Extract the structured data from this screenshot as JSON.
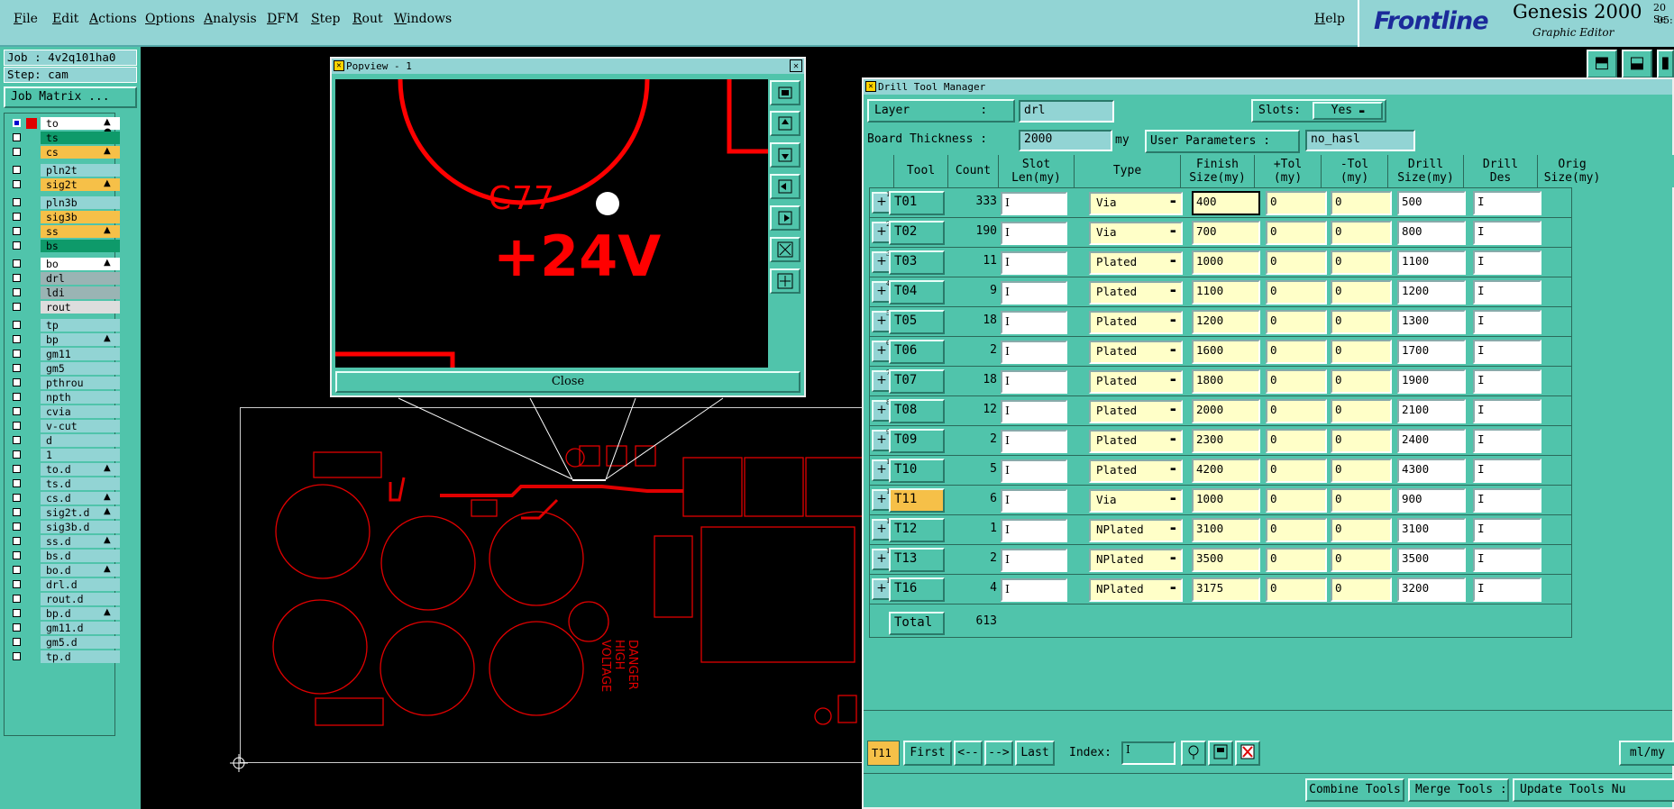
{
  "menu": [
    "File",
    "Edit",
    "Actions",
    "Options",
    "Analysis",
    "DFM",
    "Step",
    "Rout",
    "Windows"
  ],
  "help": "Help",
  "logo": {
    "brand": "Frontline",
    "product": "Genesis 2000",
    "sub": "Graphic Editor",
    "date1": "20 Se",
    "date2": "05:"
  },
  "left": {
    "job": "Job : 4v2q101ha0",
    "step": "Step: cam",
    "matrix_btn": "Job Matrix ...",
    "layers": [
      {
        "name": "to",
        "color": "#ffffff",
        "flag": "▲ ●",
        "sel": true
      },
      {
        "name": "ts",
        "color": "#0e9a6a",
        "flag": ""
      },
      {
        "name": "cs",
        "color": "#f6c048",
        "flag": "▲"
      },
      {
        "name": "pln2t",
        "color": "#92d4d4",
        "flag": ""
      },
      {
        "name": "sig2t",
        "color": "#f6c048",
        "flag": "▲"
      },
      {
        "name": "pln3b",
        "color": "#92d4d4",
        "flag": ""
      },
      {
        "name": "sig3b",
        "color": "#f6c048",
        "flag": ""
      },
      {
        "name": "ss",
        "color": "#f6c048",
        "flag": "▲"
      },
      {
        "name": "bs",
        "color": "#0e9a6a",
        "flag": ""
      },
      {
        "name": "bo",
        "color": "#ffffff",
        "flag": "▲"
      },
      {
        "name": "drl",
        "color": "#9ab4b4",
        "flag": ""
      },
      {
        "name": "ldi",
        "color": "#9ab4b4",
        "flag": ""
      },
      {
        "name": "rout",
        "color": "#dddddd",
        "flag": ""
      },
      {
        "name": "tp",
        "color": "#92d4d4",
        "flag": ""
      },
      {
        "name": "bp",
        "color": "#92d4d4",
        "flag": "▲"
      },
      {
        "name": "gm11",
        "color": "#92d4d4",
        "flag": ""
      },
      {
        "name": "gm5",
        "color": "#92d4d4",
        "flag": ""
      },
      {
        "name": "pthrou",
        "color": "#92d4d4",
        "flag": ""
      },
      {
        "name": "npth",
        "color": "#92d4d4",
        "flag": ""
      },
      {
        "name": "cvia",
        "color": "#92d4d4",
        "flag": ""
      },
      {
        "name": "v-cut",
        "color": "#92d4d4",
        "flag": ""
      },
      {
        "name": "d",
        "color": "#92d4d4",
        "flag": ""
      },
      {
        "name": "1",
        "color": "#92d4d4",
        "flag": ""
      },
      {
        "name": "to.d",
        "color": "#92d4d4",
        "flag": "▲"
      },
      {
        "name": "ts.d",
        "color": "#92d4d4",
        "flag": ""
      },
      {
        "name": "cs.d",
        "color": "#92d4d4",
        "flag": "▲"
      },
      {
        "name": "sig2t.d",
        "color": "#92d4d4",
        "flag": "▲"
      },
      {
        "name": "sig3b.d",
        "color": "#92d4d4",
        "flag": ""
      },
      {
        "name": "ss.d",
        "color": "#92d4d4",
        "flag": "▲"
      },
      {
        "name": "bs.d",
        "color": "#92d4d4",
        "flag": ""
      },
      {
        "name": "bo.d",
        "color": "#92d4d4",
        "flag": "▲"
      },
      {
        "name": "drl.d",
        "color": "#92d4d4",
        "flag": ""
      },
      {
        "name": "rout.d",
        "color": "#92d4d4",
        "flag": ""
      },
      {
        "name": "bp.d",
        "color": "#92d4d4",
        "flag": "▲"
      },
      {
        "name": "gm11.d",
        "color": "#92d4d4",
        "flag": ""
      },
      {
        "name": "gm5.d",
        "color": "#92d4d4",
        "flag": ""
      },
      {
        "name": "tp.d",
        "color": "#92d4d4",
        "flag": ""
      }
    ]
  },
  "popview": {
    "title": "Popview - 1",
    "close_x": "✕",
    "close_btn": "Close",
    "label_c77": "C77",
    "label_volt": "+24V"
  },
  "dtm": {
    "title": "Drill Tool Manager",
    "layer_label": "Layer          :",
    "layer_value": "drl",
    "slots_label": "Slots:",
    "slots_value": "Yes",
    "thickness_label": "Board Thickness :",
    "thickness_value": "2000",
    "thickness_unit": "my",
    "user_params_label": "User Parameters :",
    "user_params_value": "no_hasl",
    "headers": [
      "Tool",
      "Count",
      "Slot\nLen(my)",
      "Type",
      "Finish\nSize(my)",
      "+Tol\n(my)",
      "-Tol\n(my)",
      "Drill\nSize(my)",
      "Drill\nDes",
      "Orig\nSize(my)"
    ],
    "rows": [
      {
        "tool": "T01",
        "count": "333",
        "type": "Via",
        "finish": "400",
        "ptol": "0",
        "mtol": "0",
        "drill": "500",
        "sub": "1"
      },
      {
        "tool": "T02",
        "count": "190",
        "type": "Via",
        "finish": "700",
        "ptol": "0",
        "mtol": "0",
        "drill": "800",
        "sub": "2"
      },
      {
        "tool": "T03",
        "count": "11",
        "type": "Plated",
        "finish": "1000",
        "ptol": "0",
        "mtol": "0",
        "drill": "1100",
        "sub": "3"
      },
      {
        "tool": "T04",
        "count": "9",
        "type": "Plated",
        "finish": "1100",
        "ptol": "0",
        "mtol": "0",
        "drill": "1200",
        "sub": "4"
      },
      {
        "tool": "T05",
        "count": "18",
        "type": "Plated",
        "finish": "1200",
        "ptol": "0",
        "mtol": "0",
        "drill": "1300",
        "sub": "5"
      },
      {
        "tool": "T06",
        "count": "2",
        "type": "Plated",
        "finish": "1600",
        "ptol": "0",
        "mtol": "0",
        "drill": "1700",
        "sub": "6"
      },
      {
        "tool": "T07",
        "count": "18",
        "type": "Plated",
        "finish": "1800",
        "ptol": "0",
        "mtol": "0",
        "drill": "1900",
        "sub": "7"
      },
      {
        "tool": "T08",
        "count": "12",
        "type": "Plated",
        "finish": "2000",
        "ptol": "0",
        "mtol": "0",
        "drill": "2100",
        "sub": "8"
      },
      {
        "tool": "T09",
        "count": "2",
        "type": "Plated",
        "finish": "2300",
        "ptol": "0",
        "mtol": "0",
        "drill": "2400",
        "sub": "9"
      },
      {
        "tool": "T10",
        "count": "5",
        "type": "Plated",
        "finish": "4200",
        "ptol": "0",
        "mtol": "0",
        "drill": "4300",
        "sub": "10"
      },
      {
        "tool": "T11",
        "count": "6",
        "type": "Via",
        "finish": "1000",
        "ptol": "0",
        "mtol": "0",
        "drill": "900",
        "sub": "11",
        "active": true
      },
      {
        "tool": "T12",
        "count": "1",
        "type": "NPlated",
        "finish": "3100",
        "ptol": "0",
        "mtol": "0",
        "drill": "3100",
        "sub": "12"
      },
      {
        "tool": "T13",
        "count": "2",
        "type": "NPlated",
        "finish": "3500",
        "ptol": "0",
        "mtol": "0",
        "drill": "3500",
        "sub": "13"
      },
      {
        "tool": "T16",
        "count": "4",
        "type": "NPlated",
        "finish": "3175",
        "ptol": "0",
        "mtol": "0",
        "drill": "3200",
        "sub": "14"
      }
    ],
    "total_label": "Total",
    "total_value": "613",
    "nav": {
      "current": "T11",
      "first": "First",
      "prev": "<--",
      "next": "-->",
      "last": "Last",
      "index_label": "Index:",
      "units": "ml/my"
    },
    "bottom": {
      "combine": "Combine Tools",
      "merge": "Merge Tools :",
      "update": "Update Tools Nu"
    }
  },
  "colors": {
    "panel": "#50c4ab",
    "menubar": "#92d4d4",
    "copper": "#ff0000",
    "field": "#ffffc8",
    "active": "#f6c048"
  }
}
